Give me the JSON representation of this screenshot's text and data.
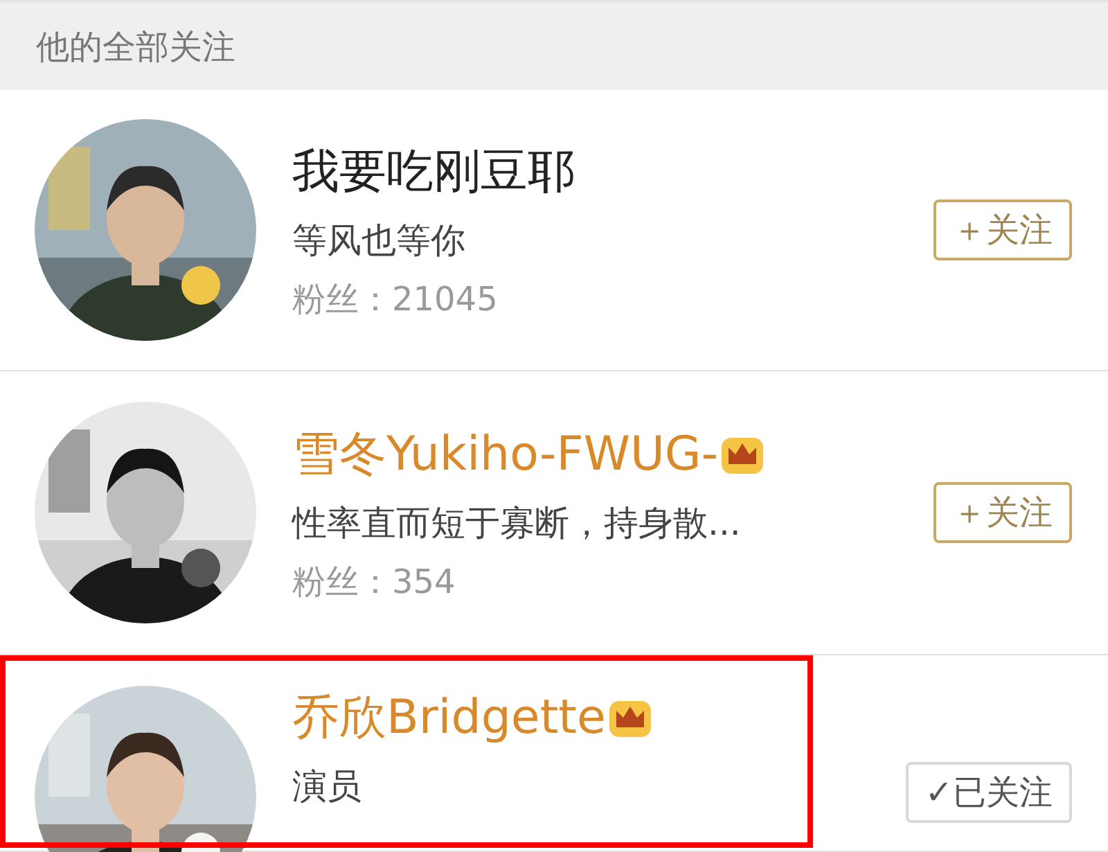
{
  "header": {
    "title": "他的全部关注"
  },
  "users": [
    {
      "name": "我要吃刚豆耶",
      "vip": false,
      "bio": "等风也等你",
      "fans_label": "粉丝：",
      "fans": "21045",
      "button": {
        "label": "＋关注",
        "followed": false
      },
      "highlighted": false
    },
    {
      "name": "雪冬Yukiho-FWUG-",
      "vip": true,
      "bio": "性率直而短于寡断，持身散...",
      "fans_label": "粉丝：",
      "fans": "354",
      "button": {
        "label": "＋关注",
        "followed": false
      },
      "highlighted": false
    },
    {
      "name": "乔欣Bridgette",
      "vip": true,
      "bio": "演员",
      "button": {
        "label": "✓已关注",
        "followed": true
      },
      "highlighted": true
    }
  ]
}
